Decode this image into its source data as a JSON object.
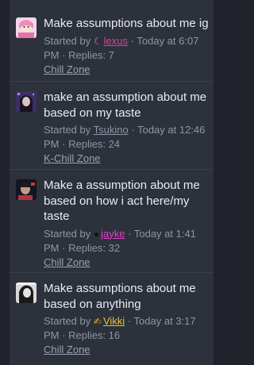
{
  "threads": [
    {
      "title": "Make assumptions about me ig",
      "started_by": "Started by",
      "user_icon": "☾",
      "user": "lexus",
      "user_color": "#e0409f",
      "icon_color": "#d36ad8",
      "time": "Today at 6:07 PM",
      "replies": "Replies: 7",
      "forum": "Chill Zone"
    },
    {
      "title": "make an assumption about me based on my taste",
      "started_by": "Started by",
      "user_icon": "",
      "user": "Tsukino",
      "user_color": "#8f97a4",
      "time": "Today at 12:46 PM",
      "replies": "Replies: 24",
      "forum": "K-Chill Zone"
    },
    {
      "title": "Make a assumption about me based on how i act here/my taste",
      "started_by": "Started by",
      "user_icon": "●",
      "user": "jayke",
      "user_color": "#e040c8",
      "icon_color": "#111111",
      "time": "Today at 1:41 PM",
      "replies": "Replies: 32",
      "forum": "Chill Zone"
    },
    {
      "title": "Make assumptions about me based on anything",
      "started_by": "Started by",
      "user_icon": "✍",
      "user": "Vikki",
      "user_color": "#f0c230",
      "icon_color": "#f0b020",
      "time": "Today at 3:17 PM",
      "replies": "Replies: 16",
      "forum": "Chill Zone"
    }
  ],
  "separator": "·"
}
